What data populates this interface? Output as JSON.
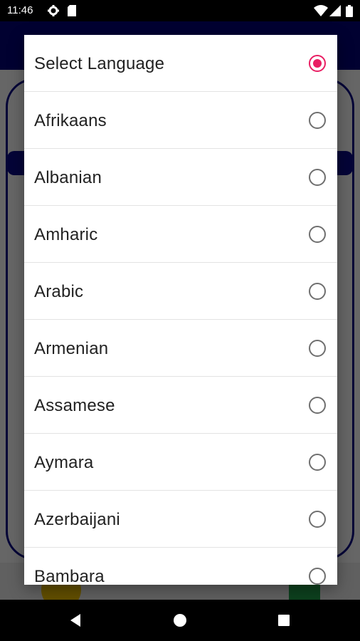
{
  "status_bar": {
    "time": "11:46",
    "icons": [
      "gear-icon",
      "sd-card-icon",
      "wifi-icon",
      "signal-icon",
      "battery-icon"
    ]
  },
  "dialog": {
    "items": [
      {
        "label": "Select Language",
        "selected": true
      },
      {
        "label": "Afrikaans",
        "selected": false
      },
      {
        "label": "Albanian",
        "selected": false
      },
      {
        "label": "Amharic",
        "selected": false
      },
      {
        "label": "Arabic",
        "selected": false
      },
      {
        "label": "Armenian",
        "selected": false
      },
      {
        "label": "Assamese",
        "selected": false
      },
      {
        "label": "Aymara",
        "selected": false
      },
      {
        "label": "Azerbaijani",
        "selected": false
      },
      {
        "label": "Bambara",
        "selected": false
      }
    ]
  },
  "colors": {
    "accent": "#e91e63",
    "toolbar": "#04047c",
    "radio_off": "#6f6f6f"
  },
  "nav_bar": {
    "icons": [
      "back-icon",
      "home-icon",
      "recents-icon"
    ]
  }
}
